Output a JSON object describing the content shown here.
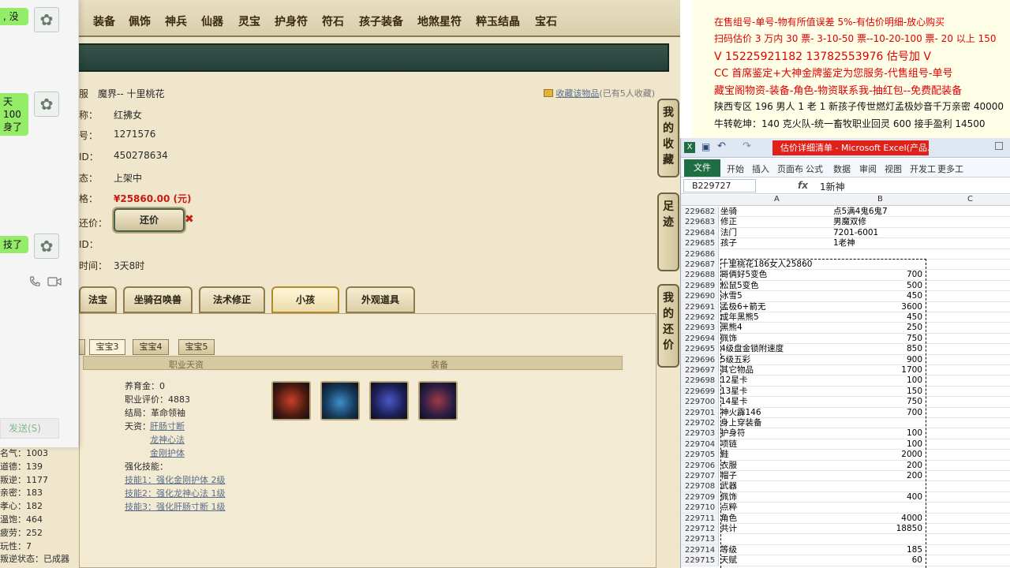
{
  "game": {
    "nav": [
      "装备",
      "佩饰",
      "神兵",
      "仙器",
      "灵宝",
      "护身符",
      "符石",
      "孩子装备",
      "地煞星符",
      "粹玉结晶",
      "宝石"
    ],
    "detail": {
      "labels": [
        "服",
        "称：",
        "号：",
        "ID：",
        "态：",
        "格：",
        "还价：",
        "ID：",
        "时间："
      ],
      "server": "魔界-- 十里桃花",
      "name": "红拂女",
      "number": "1271576",
      "id": "450278634",
      "status": "上架中",
      "price": "¥25860.00 (元)",
      "counter_label": "还价",
      "time_left": "3天8时",
      "fav_label": "收藏该物品",
      "fav_count": "(已有5人收藏)"
    },
    "side_buttons": [
      "我的收藏",
      "足迹",
      "我的还价"
    ],
    "tabs": [
      "法宝",
      "坐骑召唤兽",
      "法术修正",
      "小孩",
      "外观道具"
    ],
    "sub_tabs": [
      "宝宝3",
      "宝宝4",
      "宝宝5"
    ],
    "col_headers": {
      "career": "职业天资",
      "equip": "装备"
    },
    "child": {
      "raising_money": "养育金：0",
      "career_score": "职业评价：4883",
      "ending": "结局：革命领袖",
      "talent_label": "天资：",
      "talents": [
        "肝肠寸断",
        "龙神心法",
        "金刚护体"
      ],
      "skill_title": "强化技能：",
      "skills": [
        "技能1：强化金刚护体 2级",
        "技能2：强化龙神心法 1级",
        "技能3：强化肝肠寸断 1级"
      ]
    },
    "left_stats": [
      "名气：1003",
      "道德：139",
      "叛逆：1177",
      "亲密：183",
      "孝心：182",
      "温饱：464",
      "疲劳：252",
      "玩性：7",
      "叛逆状态：已成器"
    ]
  },
  "chat": {
    "bubbles": [
      ", 没",
      "天100\n身了",
      "技了"
    ],
    "send_label": "发送(S)",
    "avatar_glyph": "✿"
  },
  "ad": {
    "lines": [
      "在售组号-单号-物有所值误差 5%-有估价明细-放心购买",
      "扫码估价 3 万内 30 票- 3-10-50 票--10-20-100 票- 20 以上 150",
      "V 15225921182   13782553976   估号加 V",
      "CC 首席鉴定+大神金牌鉴定为您服务-代售组号-单号",
      "藏宝阁物资-装备-角色-物资联系我-抽红包--免费配装备",
      "陕西专区 196 男人 1 老 1 新孩子传世燃灯孟极妙音千万亲密 40000",
      "牛转乾坤：140 克火队-统一畜牧职业回灵 600 接手盈利 14500"
    ],
    "colors": {
      "red": "#e00000",
      "dark": "#111111"
    }
  },
  "excel": {
    "title": "估价详细清单 - Microsoft Excel(产品...",
    "ribbon": [
      "开始",
      "插入",
      "页面布",
      "公式",
      "数据",
      "审阅",
      "视图",
      "开发工",
      "更多工"
    ],
    "file_label": "文件",
    "name_box": "B229727",
    "fx": "fx",
    "formula_value": "1新神",
    "col_headers": [
      "A",
      "B",
      "C"
    ],
    "rows": [
      {
        "n": "229682",
        "a": "坐骑",
        "b": "点5满4鬼6鬼7",
        "num": false
      },
      {
        "n": "229683",
        "a": "修正",
        "b": "男魔双修",
        "num": false
      },
      {
        "n": "229684",
        "a": "法门",
        "b": "7201-6001",
        "num": false
      },
      {
        "n": "229685",
        "a": "孩子",
        "b": "1老神",
        "num": false
      },
      {
        "n": "229686",
        "a": "",
        "b": "",
        "num": false
      },
      {
        "n": "229687",
        "a": "十里桃花186女人25860",
        "b": "",
        "num": false
      },
      {
        "n": "229688",
        "a": "哥俩好5变色",
        "b": "700",
        "num": true
      },
      {
        "n": "229689",
        "a": "松鼠5变色",
        "b": "500",
        "num": true
      },
      {
        "n": "229690",
        "a": "冰雪5",
        "b": "450",
        "num": true
      },
      {
        "n": "229691",
        "a": "孟极6+箭无",
        "b": "3600",
        "num": true
      },
      {
        "n": "229692",
        "a": "成年黑熊5",
        "b": "450",
        "num": true
      },
      {
        "n": "229693",
        "a": "黑熊4",
        "b": "250",
        "num": true
      },
      {
        "n": "229694",
        "a": "佩饰",
        "b": "750",
        "num": true
      },
      {
        "n": "229695",
        "a": "4级盘金锁附速度",
        "b": "850",
        "num": true
      },
      {
        "n": "229696",
        "a": "5级五彩",
        "b": "900",
        "num": true
      },
      {
        "n": "229697",
        "a": "其它物品",
        "b": "1700",
        "num": true
      },
      {
        "n": "229698",
        "a": "12星卡",
        "b": "100",
        "num": true
      },
      {
        "n": "229699",
        "a": "13星卡",
        "b": "150",
        "num": true
      },
      {
        "n": "229700",
        "a": "14星卡",
        "b": "750",
        "num": true
      },
      {
        "n": "229701",
        "a": "神火霹146",
        "b": "700",
        "num": true
      },
      {
        "n": "229702",
        "a": "身上穿装备",
        "b": "",
        "num": false
      },
      {
        "n": "229703",
        "a": "护身符",
        "b": "100",
        "num": true
      },
      {
        "n": "229704",
        "a": "项链",
        "b": "100",
        "num": true
      },
      {
        "n": "229705",
        "a": "鞋",
        "b": "2000",
        "num": true
      },
      {
        "n": "229706",
        "a": "衣服",
        "b": "200",
        "num": true
      },
      {
        "n": "229707",
        "a": "帽子",
        "b": "200",
        "num": true
      },
      {
        "n": "229708",
        "a": "武器",
        "b": "",
        "num": false
      },
      {
        "n": "229709",
        "a": "佩饰",
        "b": "400",
        "num": true
      },
      {
        "n": "229710",
        "a": "点粹",
        "b": "",
        "num": false
      },
      {
        "n": "229711",
        "a": "角色",
        "b": "4000",
        "num": true
      },
      {
        "n": "229712",
        "a": "共计",
        "b": "18850",
        "num": true
      },
      {
        "n": "229713",
        "a": "",
        "b": "",
        "num": false
      },
      {
        "n": "229714",
        "a": "等级",
        "b": "185",
        "num": true
      },
      {
        "n": "229715",
        "a": "天赋",
        "b": "60",
        "num": true
      }
    ]
  }
}
